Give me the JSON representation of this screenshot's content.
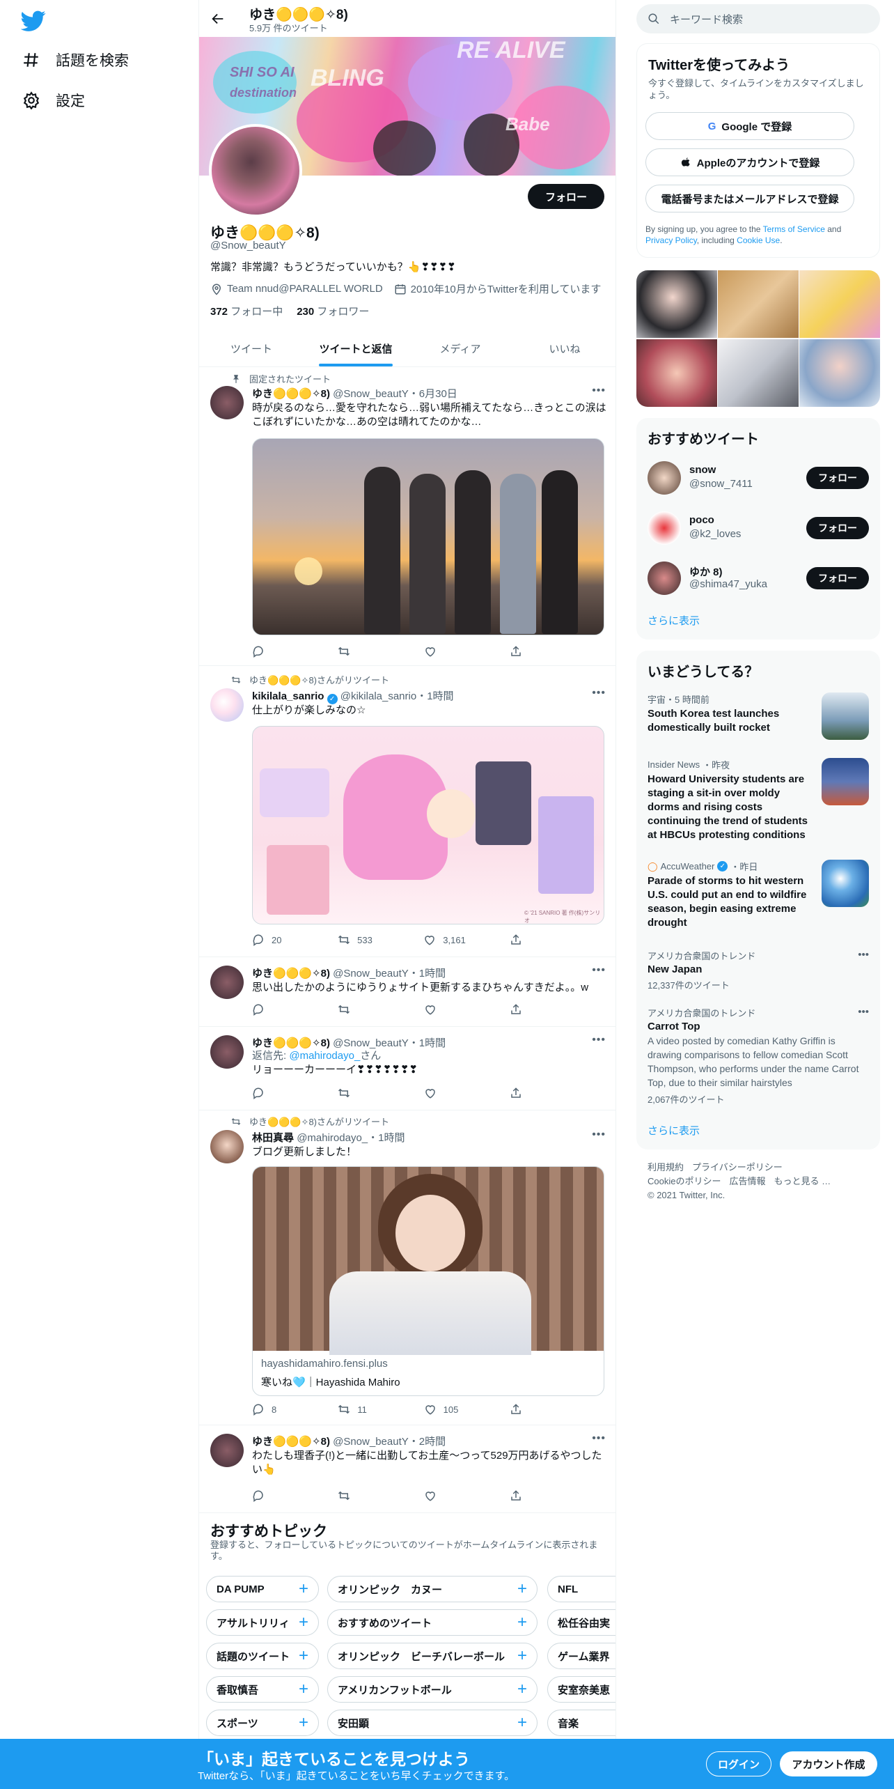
{
  "colors": {
    "accent": "#1d9bf0",
    "text": "#0f1419",
    "muted": "#536471",
    "border": "#eff3f4",
    "like_red": "#f4212e"
  },
  "nav": {
    "explore_label": "話題を検索",
    "settings_label": "設定",
    "logo_icon": "twitter-bird-icon"
  },
  "header": {
    "name": "ゆき🟡🟡🟡✧8)",
    "tweet_count": "5.9万 件のツイート"
  },
  "profile": {
    "name": "ゆき🟡🟡🟡✧8)",
    "handle": "@Snow_beautY",
    "bio": "常識？非常識？もうどうだっていいかも？👆❣❣❣❣",
    "location": "Team nnud@PARALLEL WORLD",
    "joined": "2010年10月からTwitterを利用しています",
    "following_count": "372",
    "following_label": "フォロー中",
    "followers_count": "230",
    "followers_label": "フォロワー",
    "follow_button": "フォロー",
    "banner_words": [
      "BLING",
      "RE ALIVE",
      "SHI SO AI",
      "destination",
      "Babe"
    ]
  },
  "tabs": [
    "ツイート",
    "ツイートと返信",
    "メディア",
    "いいね"
  ],
  "tweets": [
    {
      "context": "固定されたツイート",
      "name": "ゆき🟡🟡🟡✧8)",
      "handle": "@Snow_beautY",
      "time": "6月30日",
      "text": "時が戻るのなら…愛を守れたなら…弱い場所補えてたなら…きっとこの涙はこぼれずにいたかな…あの空は晴れてたのかな…",
      "reply": "",
      "retweet": "",
      "like": ""
    },
    {
      "context": "ゆき🟡🟡🟡✧8)さんがリツイート",
      "name": "kikilala_sanrio",
      "handle": "@kikilala_sanrio",
      "time": "1時間",
      "text": "仕上がりが楽しみなの☆",
      "reply": "20",
      "retweet": "533",
      "like": "3,161",
      "image_credit": "© '21 SANRIO 著 作(株)サンリオ"
    },
    {
      "context": "",
      "name": "ゆき🟡🟡🟡✧8)",
      "handle": "@Snow_beautY",
      "time": "1時間",
      "text": "思い出したかのようにゆうりょサイト更新するまひちゃんすきだよ。。w",
      "reply": "",
      "retweet": "",
      "like": ""
    },
    {
      "context": "",
      "name": "ゆき🟡🟡🟡✧8)",
      "handle": "@Snow_beautY",
      "time": "1時間",
      "reply_prefix": "返信先: ",
      "reply_to": "@mahirodayo_",
      "reply_suffix": "さん",
      "text": "リョーーーカーーーイ❣❣❣❣❣❣❣",
      "reply": "",
      "retweet": "",
      "like": ""
    },
    {
      "context": "ゆき🟡🟡🟡✧8)さんがリツイート",
      "name": "林田真尋",
      "handle": "@mahirodayo_",
      "time": "1時間",
      "text": "ブログ更新しました！",
      "link_url": "hayashidamahiro.fensi.plus",
      "link_title": "寒いね🩵｜Hayashida Mahiro",
      "reply": "8",
      "retweet": "11",
      "like": "105"
    },
    {
      "context": "",
      "name": "ゆき🟡🟡🟡✧8)",
      "handle": "@Snow_beautY",
      "time": "2時間",
      "text": "わたしも理香子(!)と一緒に出勤してお土産〜つって529万円あげるやつしたい👆",
      "reply": "",
      "retweet": "",
      "like": ""
    }
  ],
  "topics": {
    "title": "おすすめトピック",
    "subtitle": "登録すると、フォローしているトピックについてのツイートがホームタイムラインに表示されます。",
    "rows": [
      [
        "DA PUMP",
        "オリンピック　カヌー",
        "NFL"
      ],
      [
        "アサルトリリィ",
        "おすすめのツイート",
        "松任谷由実"
      ],
      [
        "話題のツイート",
        "オリンピック　ビーチバレーボール",
        "ゲーム業界"
      ],
      [
        "香取慎吾",
        "アメリカンフットボール",
        "安室奈美恵"
      ],
      [
        "スポーツ",
        "安田顕",
        "音楽"
      ]
    ]
  },
  "right": {
    "search_placeholder": "キーワード検索",
    "signup": {
      "title": "Twitterを使ってみよう",
      "subtitle": "今すぐ登録して、タイムラインをカスタマイズしましょう。",
      "google": "Google で登録",
      "apple": "Appleのアカウントで登録",
      "phone": "電話番号またはメールアドレスで登録",
      "terms_1": "By signing up, you agree to the ",
      "terms_link": "Terms of Service",
      "terms_2": " and ",
      "privacy": "Privacy Policy",
      "terms_3": ", including ",
      "cookie": "Cookie Use",
      "terms_4": "."
    },
    "recommended": {
      "title": "おすすめツイート",
      "users": [
        {
          "name": "snow",
          "handle": "@snow_7411",
          "button": "フォロー"
        },
        {
          "name": "poco",
          "handle": "@k2_loves",
          "button": "フォロー"
        },
        {
          "name": "ゆか 8)",
          "handle": "@shima47_yuka",
          "button": "フォロー"
        }
      ],
      "more": "さらに表示"
    },
    "happening": {
      "title": "いまどうしてる？",
      "news": [
        {
          "source": "宇宙・5 時間前",
          "title": "South Korea test launches domestically built rocket"
        },
        {
          "source": "Insider News",
          "time": "・昨夜",
          "title": "Howard University students are staging a sit-in over moldy dorms and rising costs continuing the trend of students at HBCUs protesting conditions"
        },
        {
          "source": "AccuWeather",
          "time": "・昨日",
          "title": "Parade of storms to hit western U.S. could put an end to wildfire season, begin easing extreme drought"
        }
      ],
      "trends": [
        {
          "context": "アメリカ合衆国のトレンド",
          "name": "New Japan",
          "count": "12,337件のツイート"
        },
        {
          "context": "アメリカ合衆国のトレンド",
          "name": "Carrot Top",
          "desc": "A video posted by comedian Kathy Griffin is drawing comparisons to fellow comedian Scott Thompson, who performs under the name Carrot Top, due to their similar hairstyles",
          "count": "2,067件のツイート"
        }
      ],
      "more": "さらに表示"
    },
    "footer": {
      "terms": "利用規約",
      "privacy": "プライバシーポリシー",
      "cookie": "Cookieのポリシー",
      "ads": "広告情報",
      "more": "もっと見る …",
      "copyright": "© 2021 Twitter, Inc."
    }
  },
  "bottom": {
    "title": "「いま」起きていることを見つけよう",
    "subtitle": "Twitterなら、「いま」起きていることをいち早くチェックできます。",
    "login": "ログイン",
    "signup": "アカウント作成"
  }
}
